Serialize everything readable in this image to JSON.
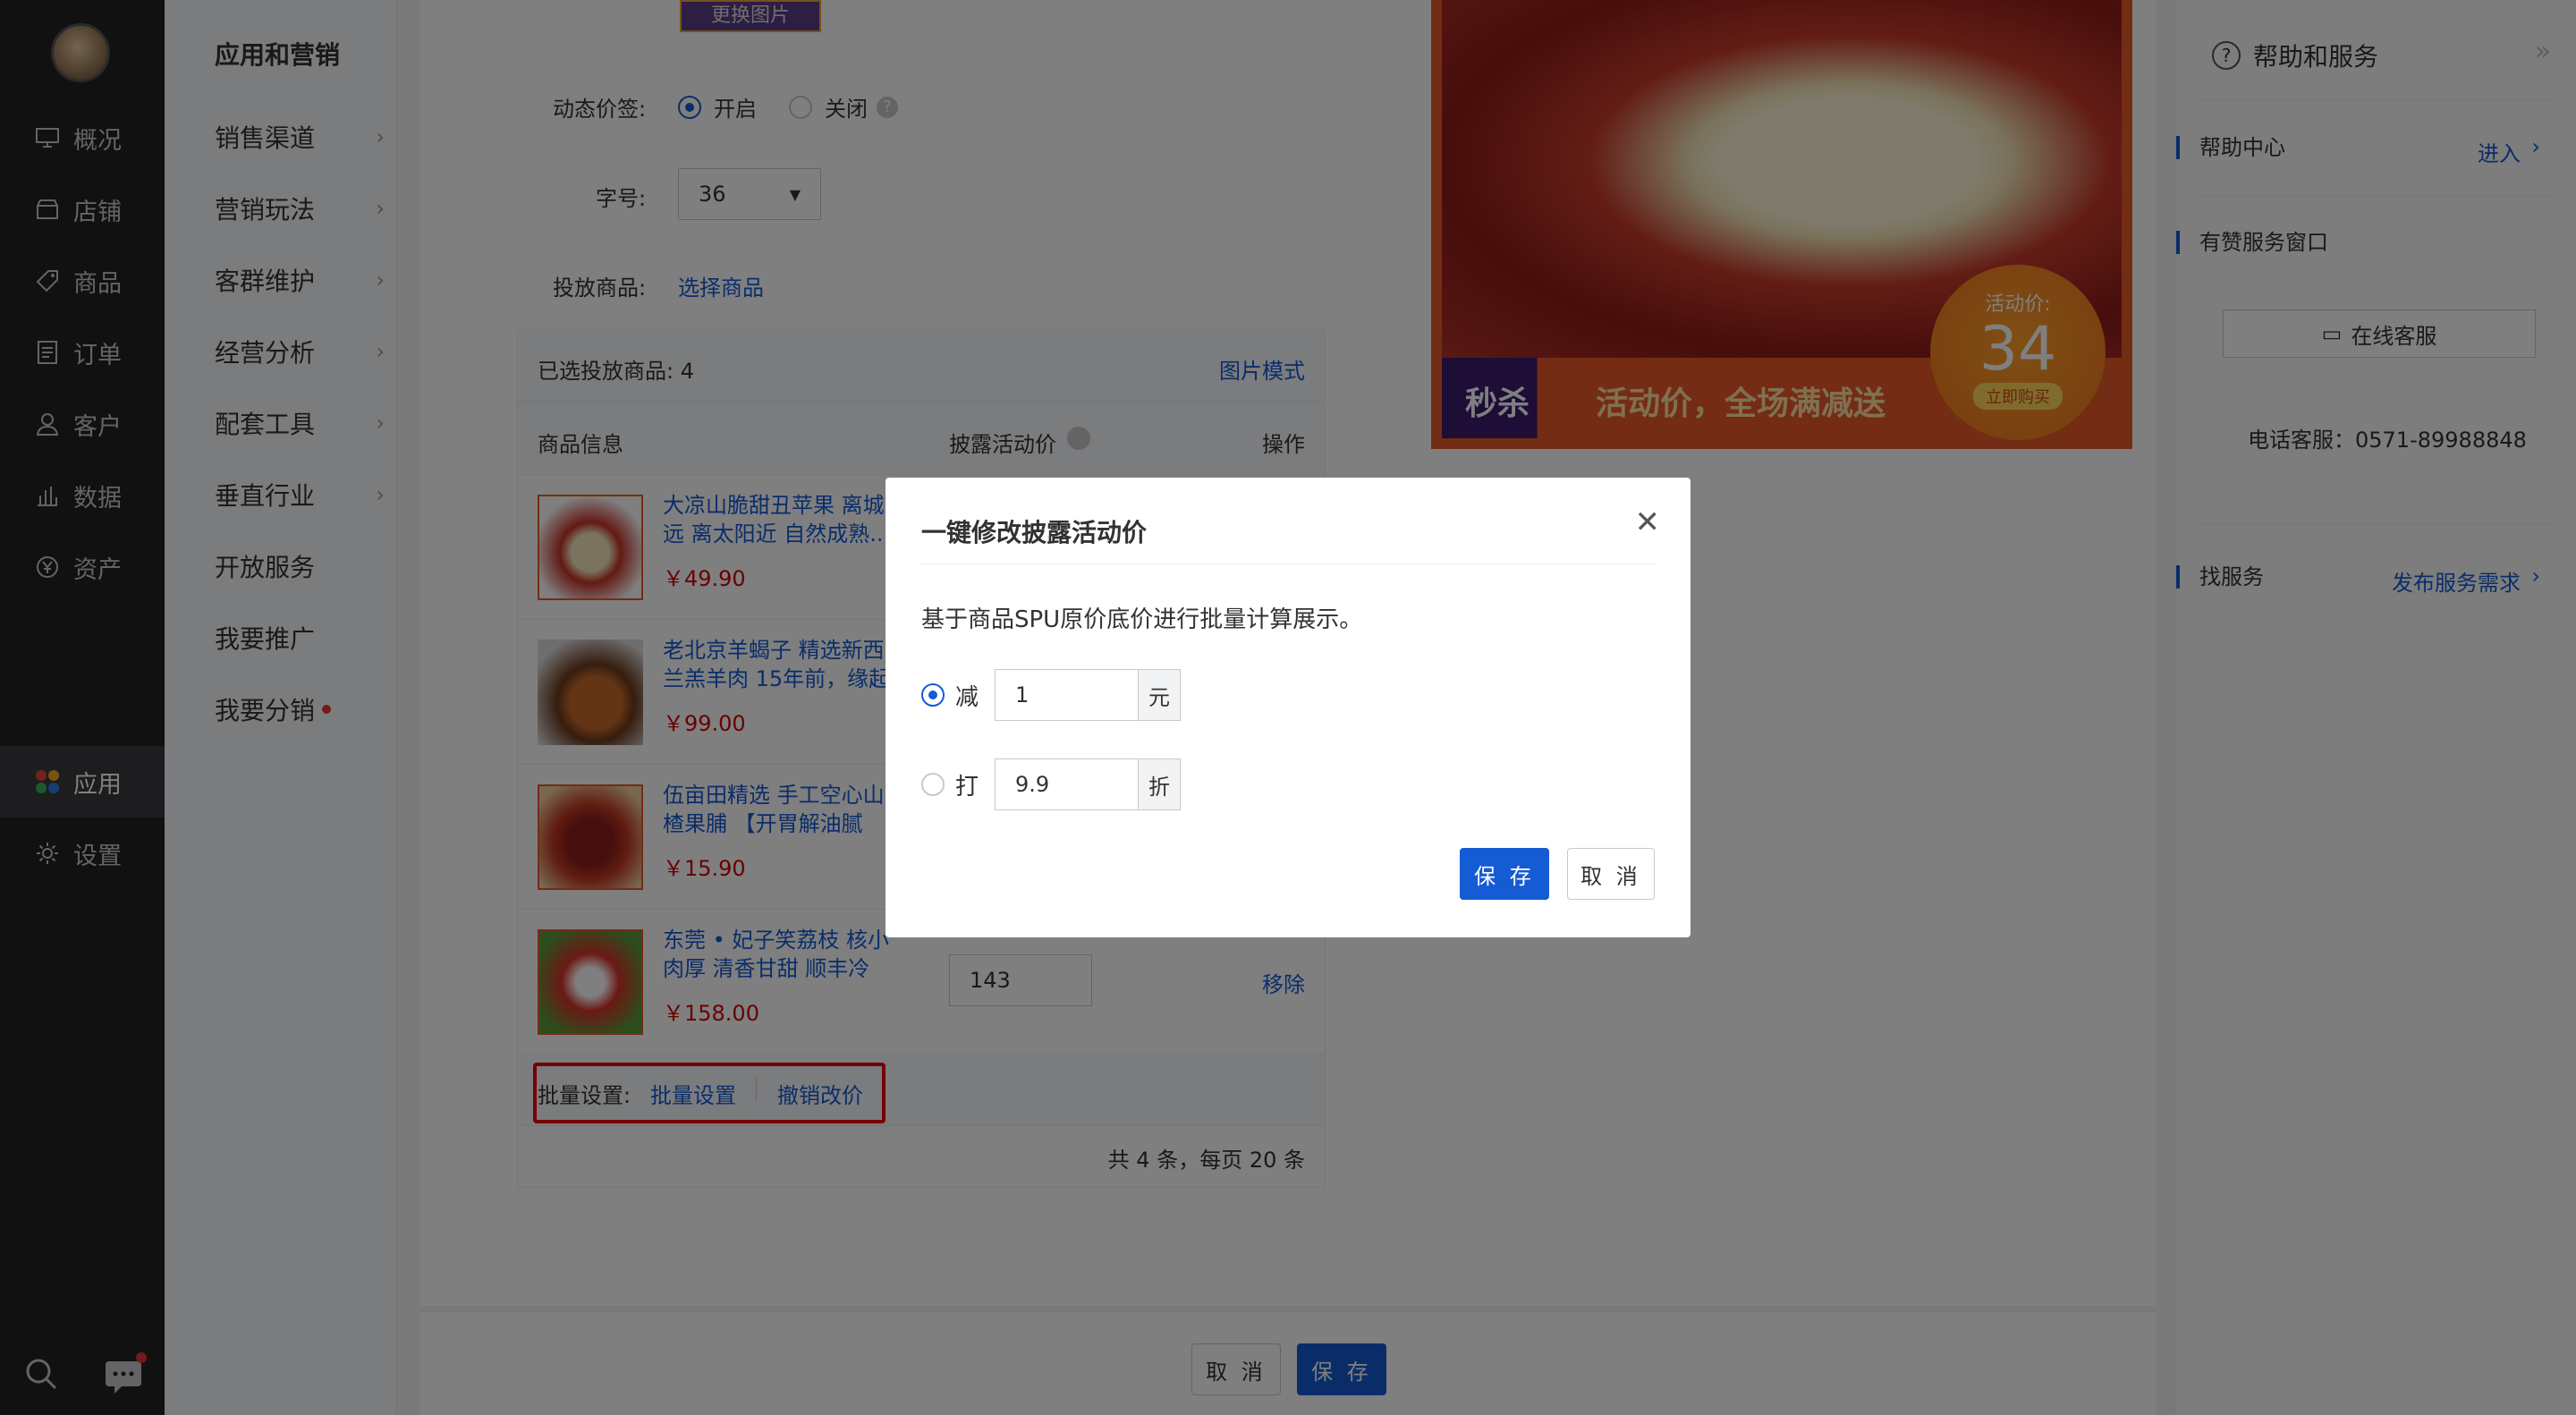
{
  "nav": {
    "items": [
      {
        "label": "概况",
        "icon": "monitor-icon"
      },
      {
        "label": "店铺",
        "icon": "store-icon"
      },
      {
        "label": "商品",
        "icon": "tag-icon"
      },
      {
        "label": "订单",
        "icon": "list-icon"
      },
      {
        "label": "客户",
        "icon": "user-icon"
      },
      {
        "label": "数据",
        "icon": "bar-chart-icon"
      },
      {
        "label": "资产",
        "icon": "yuan-icon"
      },
      {
        "label": "应用",
        "icon": "apps-icon"
      },
      {
        "label": "设置",
        "icon": "gear-icon"
      }
    ],
    "active": "应用"
  },
  "submenu": {
    "title": "应用和营销",
    "items": [
      {
        "label": "销售渠道",
        "chevron": true
      },
      {
        "label": "营销玩法",
        "chevron": true
      },
      {
        "label": "客群维护",
        "chevron": true
      },
      {
        "label": "经营分析",
        "chevron": true
      },
      {
        "label": "配套工具",
        "chevron": true
      },
      {
        "label": "垂直行业",
        "chevron": true
      },
      {
        "label": "开放服务",
        "chevron": false
      },
      {
        "label": "我要推广",
        "chevron": false
      },
      {
        "label": "我要分销",
        "chevron": false,
        "dot": true
      }
    ]
  },
  "form": {
    "change_image": "更换图片",
    "dynamic_price_label": "动态价签:",
    "dynamic_on": "开启",
    "dynamic_off": "关闭",
    "font_size_label": "字号:",
    "font_size_value": "36",
    "goods_label": "投放商品:",
    "choose_goods": "选择商品"
  },
  "goods_table": {
    "selected_text": "已选投放商品: 4",
    "image_mode": "图片模式",
    "headers": [
      "商品信息",
      "披露活动价",
      "操作"
    ],
    "rows": [
      {
        "title": "大凉山脆甜丑苹果 离城远 离太阳近 自然成熟...",
        "price": "￥49.90",
        "activity_price": "",
        "action": ""
      },
      {
        "title": "老北京羊蝎子 精选新西兰羔羊肉 15年前，缘起京...",
        "price": "￥99.00",
        "activity_price": "",
        "action": ""
      },
      {
        "title": "伍亩田精选 手工空心山楂果脯 【开胃解油腻 酸...",
        "price": "￥15.90",
        "activity_price": "",
        "action": ""
      },
      {
        "title": "东莞 • 妃子笑荔枝 核小肉厚 清香甘甜 顺丰冷链...",
        "price": "￥158.00",
        "activity_price": "143",
        "action": "移除"
      }
    ],
    "batch_label": "批量设置:",
    "batch_set": "批量设置",
    "batch_undo": "撤销改价",
    "pagination": "共 4 条，每页 20 条"
  },
  "preview": {
    "tag": "秒杀",
    "slogan": "活动价，全场满减送",
    "badge_label": "活动价:",
    "badge_price": "34",
    "badge_button": "立即购买"
  },
  "help": {
    "title": "帮助和服务",
    "help_center": "帮助中心",
    "enter": "进入",
    "service_window": "有赞服务窗口",
    "online_service": "在线客服",
    "phone": "电话客服：0571-89988848",
    "find_service": "找服务",
    "post_demand": "发布服务需求"
  },
  "bottom": {
    "cancel": "取 消",
    "save": "保 存"
  },
  "modal": {
    "title": "一键修改披露活动价",
    "description": "基于商品SPU原价底价进行批量计算展示。",
    "option_minus_label": "减",
    "option_minus_value": "1",
    "option_minus_unit": "元",
    "option_discount_label": "打",
    "option_discount_value": "9.9",
    "option_discount_unit": "折",
    "selected_option": "减",
    "save": "保 存",
    "cancel": "取 消"
  }
}
